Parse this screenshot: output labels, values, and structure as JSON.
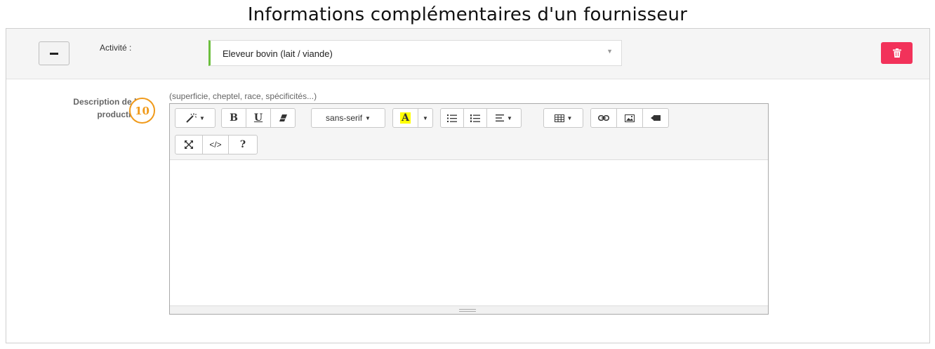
{
  "page": {
    "title": "Informations complémentaires d'un fournisseur"
  },
  "activity": {
    "label": "Activité :",
    "selected_value": "Eleveur bovin (lait / viande)",
    "accent_color": "#6cbf3e"
  },
  "delete_button": {
    "icon": "trash-icon",
    "color": "#f2325a"
  },
  "description": {
    "label_line1": "Description de la",
    "label_line2": "production",
    "hint": "(superficie, cheptel, race, spécificités...)"
  },
  "callout": {
    "number": "10",
    "color": "#f09a1a"
  },
  "toolbar": {
    "bold": "B",
    "underline": "U",
    "font_name": "sans-serif",
    "color_letter": "A",
    "codeview": "</>",
    "help": "?",
    "icons": [
      "magic-style-icon",
      "eraser-icon",
      "unordered-list-icon",
      "ordered-list-icon",
      "align-icon",
      "table-icon",
      "link-icon",
      "picture-icon",
      "video-icon",
      "fullscreen-icon"
    ]
  }
}
